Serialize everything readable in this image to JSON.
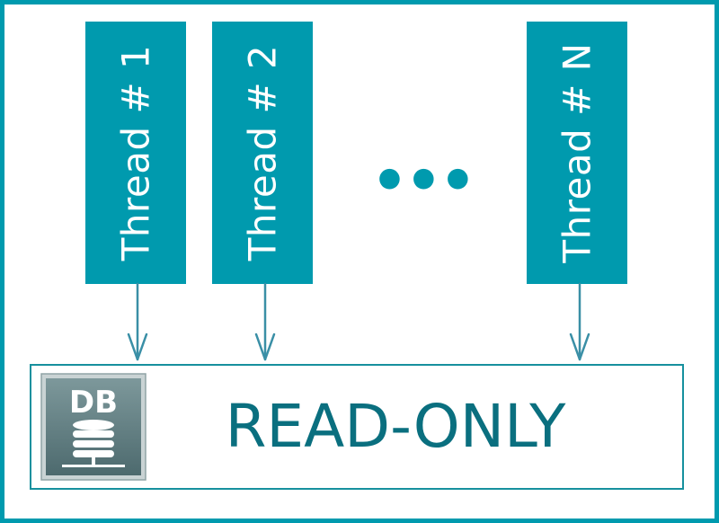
{
  "threads": [
    {
      "label": "Thread # 1"
    },
    {
      "label": "Thread # 2"
    },
    {
      "label": "Thread # N"
    }
  ],
  "ellipsis": "•••",
  "database": {
    "icon_text": "DB",
    "label": "READ-ONLY"
  },
  "colors": {
    "teal": "#009aae",
    "arrow": "#3a8fa6",
    "text_dark_teal": "#0a6f7f",
    "icon_gray": "#5f7b7f"
  }
}
